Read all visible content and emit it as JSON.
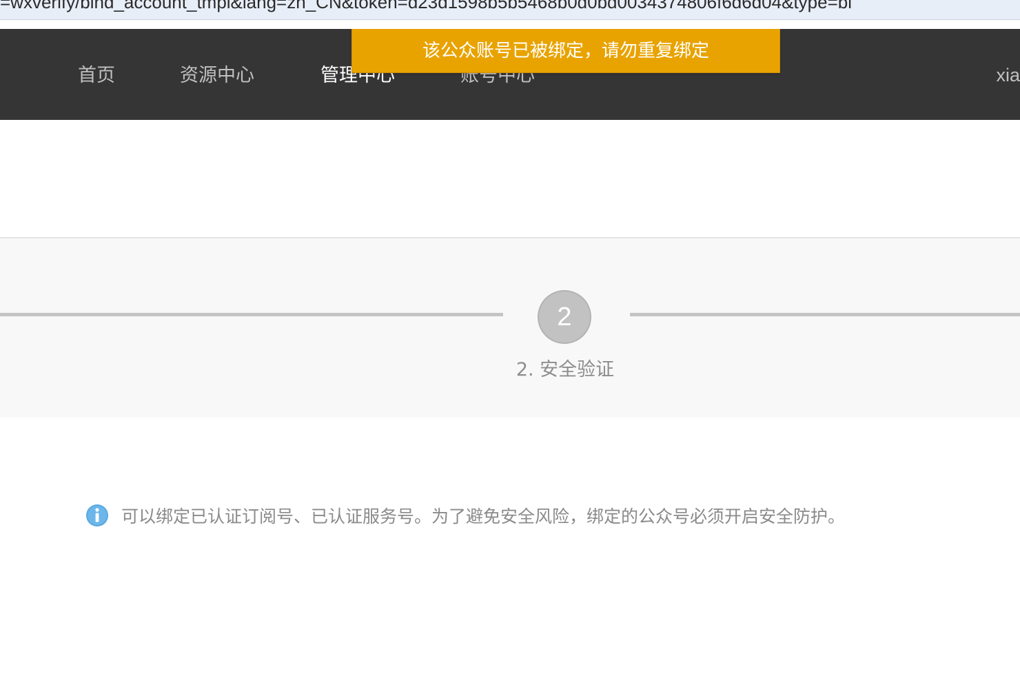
{
  "browser": {
    "url_fragment": "=wxverify/bind_account_tmpl&lang=zh_CN&token=d23d1598b5b5468b0d0bd0034374806f6d6d04&type=bi"
  },
  "topnav": {
    "items": [
      {
        "label": "首页",
        "active": false
      },
      {
        "label": "资源中心",
        "active": false
      },
      {
        "label": "管理中心",
        "active": true
      },
      {
        "label": "账号中心",
        "active": false
      }
    ],
    "user": "xiaoq"
  },
  "toast": {
    "message": "该公众账号已被绑定，请勿重复绑定",
    "color": "#e9a300"
  },
  "steps": {
    "current_number": "2",
    "current_label": "2. 安全验证"
  },
  "notice": {
    "icon": "info-icon",
    "text": "可以绑定已认证订阅号、已认证服务号。为了避免安全风险，绑定的公众号必须开启安全防护。"
  }
}
